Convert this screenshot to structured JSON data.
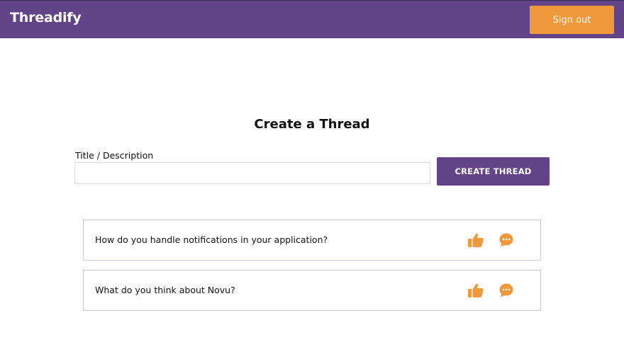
{
  "navbar": {
    "brand": "Threadify",
    "signout_label": "Sign out"
  },
  "main": {
    "heading": "Create a Thread",
    "form": {
      "title_label": "Title / Description",
      "title_value": "",
      "title_placeholder": "",
      "submit_label": "CREATE THREAD"
    },
    "threads": [
      {
        "title": "How do you handle notifications in your application?",
        "like_icon": "thumbs-up-icon",
        "comment_icon": "comment-icon"
      },
      {
        "title": "What do you think about Novu?",
        "like_icon": "thumbs-up-icon",
        "comment_icon": "comment-icon"
      }
    ]
  },
  "colors": {
    "primary": "#634488",
    "accent": "#f0993c",
    "border": "#c9c8e0"
  }
}
